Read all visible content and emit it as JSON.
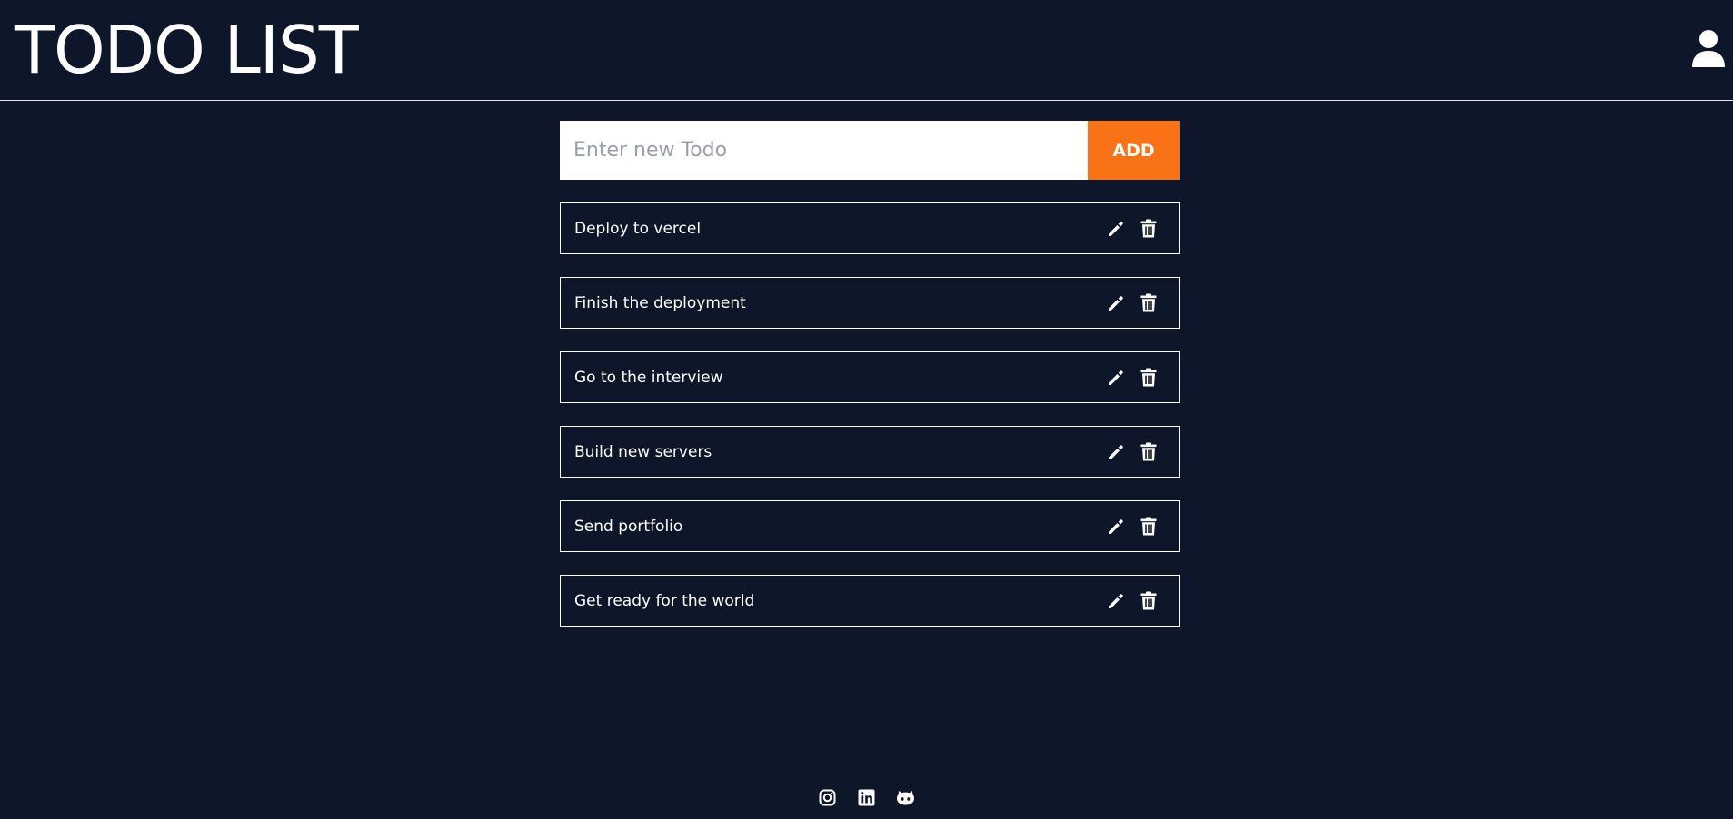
{
  "app": {
    "title": "TODO LIST",
    "user_icon": "user-icon"
  },
  "form": {
    "placeholder": "Enter new Todo",
    "value": "",
    "add_label": "ADD",
    "accent_color": "#f97316"
  },
  "todos": [
    {
      "text": "Deploy to vercel",
      "edit_icon": "pencil-icon",
      "delete_icon": "trash-icon"
    },
    {
      "text": "Finish the deployment",
      "edit_icon": "pencil-icon",
      "delete_icon": "trash-icon"
    },
    {
      "text": "Go to the interview",
      "edit_icon": "pencil-icon",
      "delete_icon": "trash-icon"
    },
    {
      "text": "Build new servers",
      "edit_icon": "pencil-icon",
      "delete_icon": "trash-icon"
    },
    {
      "text": "Send portfolio",
      "edit_icon": "pencil-icon",
      "delete_icon": "trash-icon"
    },
    {
      "text": "Get ready for the world",
      "edit_icon": "pencil-icon",
      "delete_icon": "trash-icon"
    }
  ],
  "footer": {
    "links": [
      {
        "icon": "instagram-icon"
      },
      {
        "icon": "linkedin-icon"
      },
      {
        "icon": "github-icon"
      }
    ]
  },
  "colors": {
    "background": "#0e172a",
    "text": "#ffffff",
    "border": "#ffffff"
  }
}
